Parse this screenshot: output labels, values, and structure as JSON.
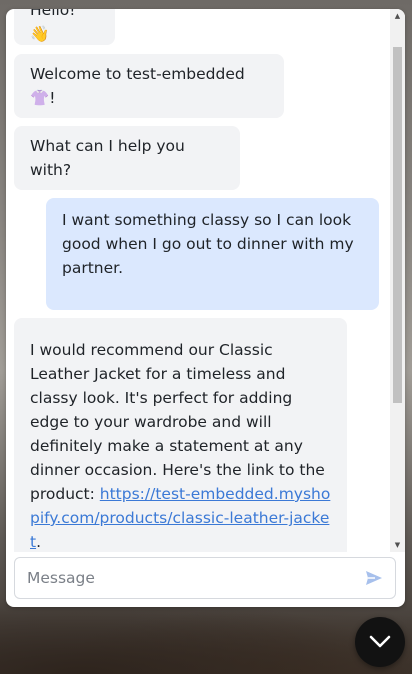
{
  "messages": {
    "hello": "Hello! 👋",
    "welcome": "Welcome to test-embedded👚!",
    "help": "What can I help you with?",
    "user": "I want something classy so I can look good when I go out to dinner with my partner.",
    "reco_text": "I would recommend our Classic Leather Jacket for a timeless and classy look. It's perfect for adding edge to your wardrobe and will definitely make a statement at any dinner occasion. Here's the link to the product:",
    "reco_link": "https://test-embedded.myshopify.com/products/classic-leather-jacket",
    "reco_end": "."
  },
  "composer": {
    "placeholder": "Message",
    "value": ""
  },
  "icons": {
    "send": "send-icon",
    "toggle": "chevron-down-icon",
    "scroll_up": "triangle-up-icon",
    "scroll_down": "triangle-down-icon"
  },
  "colors": {
    "user_bubble": "#dbe8fe",
    "bot_bubble": "#f2f3f5",
    "link": "#3b79d6",
    "send_icon": "#a7c0ec",
    "toggle_bg": "#121212"
  }
}
